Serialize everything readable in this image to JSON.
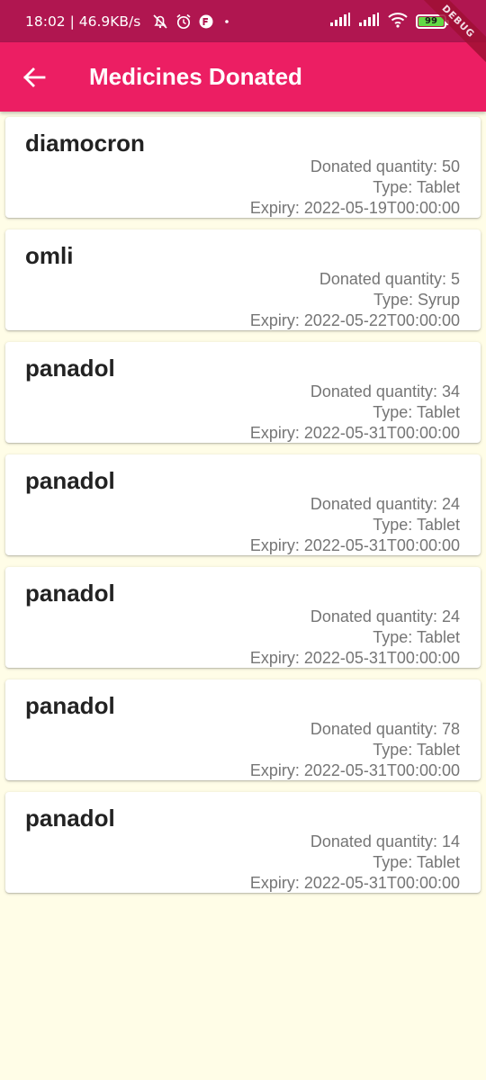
{
  "status_bar": {
    "time_speed": "18:02 | 46.9KB/s",
    "battery_level": "99",
    "debug_banner": "DEBUG",
    "icons": [
      "muted-bell-icon",
      "alarm-icon",
      "notification-app-icon",
      "dot-icon",
      "cell-signal-icon",
      "cell-signal-icon",
      "wifi-icon",
      "battery-icon"
    ]
  },
  "app_bar": {
    "back_icon": "arrow-left-icon",
    "title": "Medicines Donated",
    "color": "#ec1e63"
  },
  "medicines": [
    {
      "name": "diamocron",
      "quantity": "Donated quantity: 50",
      "type": "Type: Tablet",
      "expiry": "Expiry: 2022-05-19T00:00:00"
    },
    {
      "name": "omli",
      "quantity": "Donated quantity: 5",
      "type": "Type: Syrup",
      "expiry": "Expiry: 2022-05-22T00:00:00"
    },
    {
      "name": "panadol",
      "quantity": "Donated quantity: 34",
      "type": "Type: Tablet",
      "expiry": "Expiry: 2022-05-31T00:00:00"
    },
    {
      "name": "panadol",
      "quantity": "Donated quantity: 24",
      "type": "Type: Tablet",
      "expiry": "Expiry: 2022-05-31T00:00:00"
    },
    {
      "name": "panadol",
      "quantity": "Donated quantity: 24",
      "type": "Type: Tablet",
      "expiry": "Expiry: 2022-05-31T00:00:00"
    },
    {
      "name": "panadol",
      "quantity": "Donated quantity: 78",
      "type": "Type: Tablet",
      "expiry": "Expiry: 2022-05-31T00:00:00"
    },
    {
      "name": "panadol",
      "quantity": "Donated quantity: 14",
      "type": "Type: Tablet",
      "expiry": "Expiry: 2022-05-31T00:00:00"
    }
  ],
  "colors": {
    "status_bar": "#b01650",
    "background": "#fffde7",
    "card": "#ffffff"
  }
}
